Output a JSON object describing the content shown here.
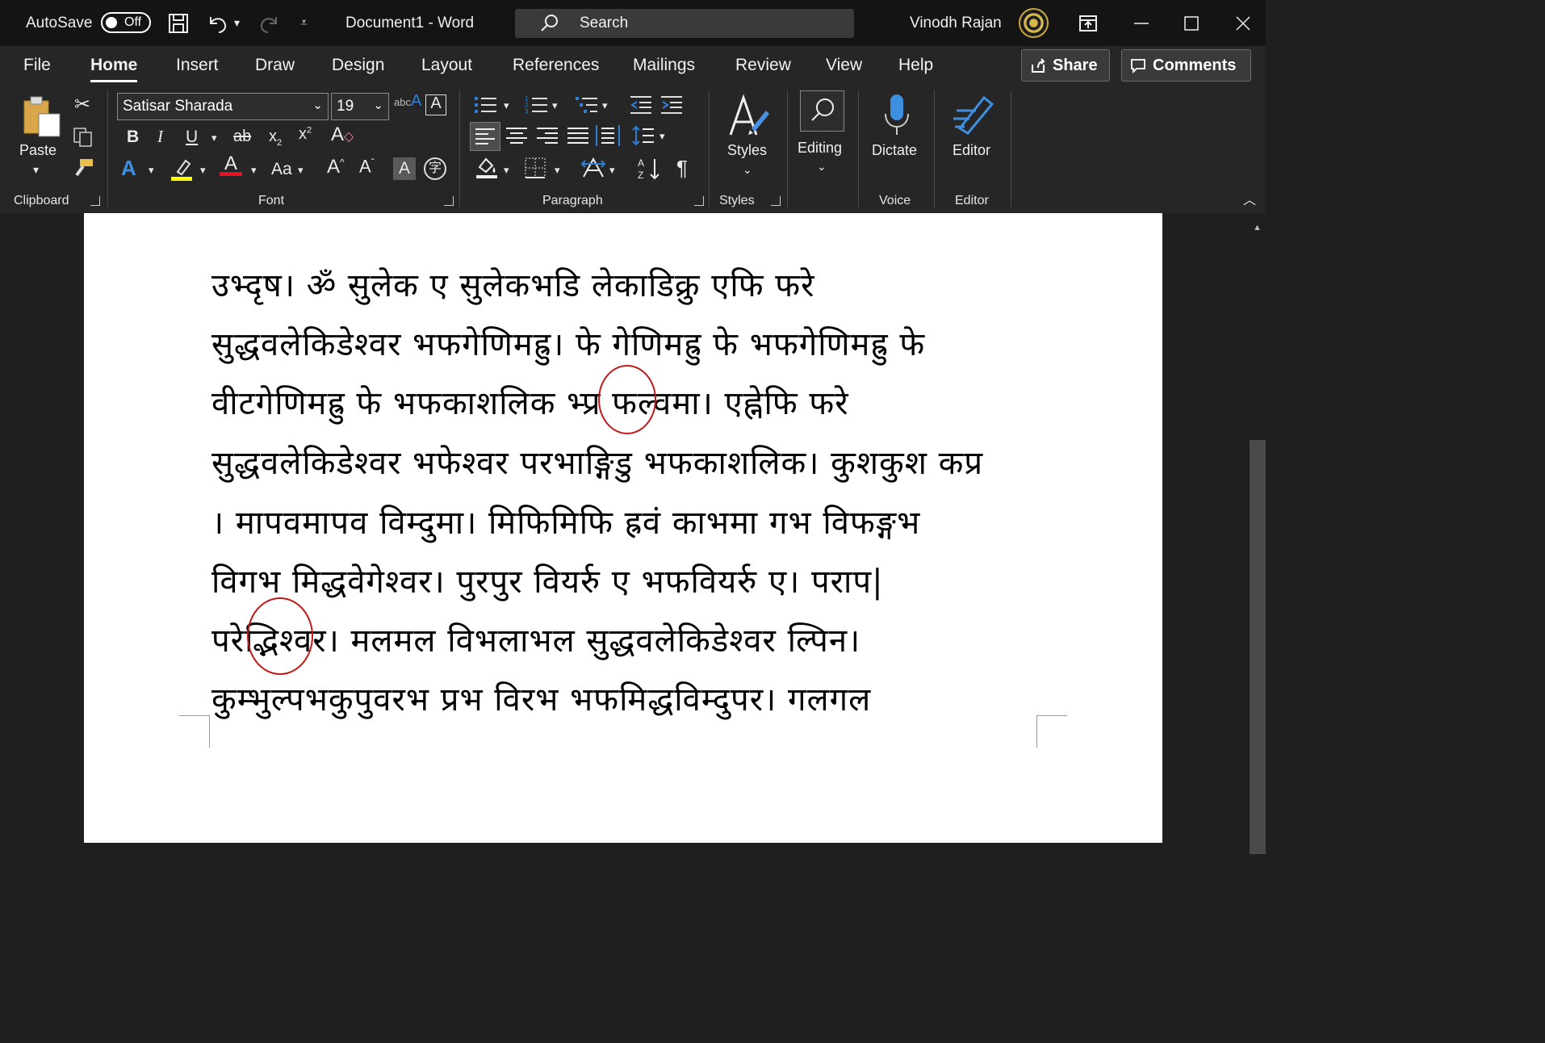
{
  "titlebar": {
    "autosave_label": "AutoSave",
    "autosave_state": "Off",
    "doc_title": "Document1  -  Word",
    "search_placeholder": "Search",
    "user_name": "Vinodh Rajan"
  },
  "tabs": [
    "File",
    "Home",
    "Insert",
    "Draw",
    "Design",
    "Layout",
    "References",
    "Mailings",
    "Review",
    "View",
    "Help"
  ],
  "active_tab": "Home",
  "share_label": "Share",
  "comments_label": "Comments",
  "ribbon": {
    "clipboard": {
      "label": "Clipboard",
      "paste": "Paste"
    },
    "font": {
      "label": "Font",
      "family": "Satisar Sharada",
      "size": "19"
    },
    "paragraph": {
      "label": "Paragraph"
    },
    "styles": {
      "label": "Styles",
      "button": "Styles"
    },
    "editing": {
      "button": "Editing"
    },
    "voice": {
      "label": "Voice",
      "button": "Dictate"
    },
    "editor": {
      "label": "Editor",
      "button": "Editor"
    }
  },
  "document": {
    "lines": [
      "उभ्दृष। ॐ सुलेक ए सुलेकभडि लेकाडिक्रु एफि फरे",
      "सुद्धवलेकिडेश्वर भफगेणिमह्रु। फे गेणिमह्रु फे भफगेणिमह्रु फे",
      "वीटगेणिमह्रु फे भफकाशलिक भ्प्र फल्वमा। एह्नेफि फरे",
      "सुद्धवलेकिडेश्वर भफेश्वर परभाङ्गिडु भफकाशलिक। कुशकुश कप्र",
      "। मापवमापव विम्दुमा। मिफिमिफि ह्रवं काभमा गभ विफङ्गभ",
      "विगभ मिद्धवेगेश्वर। पुरपुर वियर्रु ए भफवियर्रु ए। पराप|",
      "परेद्भिश्वर। मलमल विभलाभल सुद्धवलेकिडेश्वर ल्पिन।",
      "कुम्भुल्पभकुपुवरभ प्रभ विरभ भफमिद्धविम्दुपर। गलगल"
    ]
  },
  "colors": {
    "accent_blue": "#2f7fd6",
    "highlight_yellow": "#ffff00",
    "font_red": "#e81123",
    "circle_red": "#c01818"
  }
}
